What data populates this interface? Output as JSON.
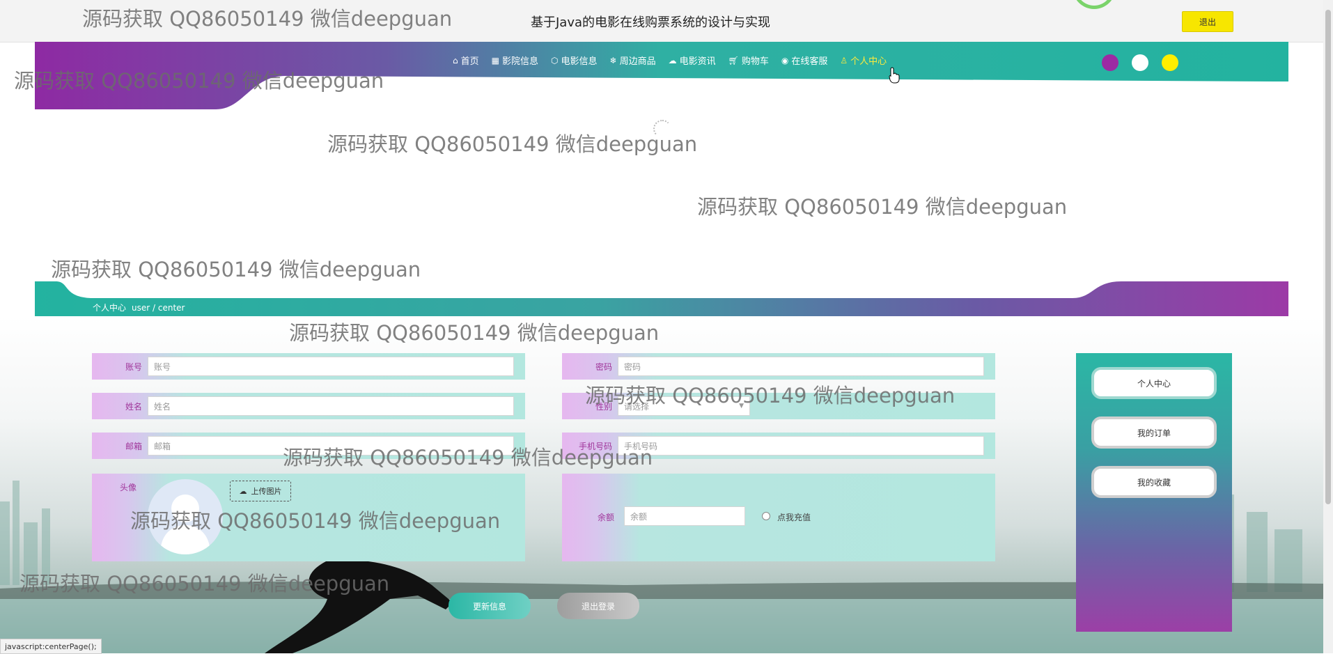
{
  "header": {
    "title": "基于Java的电影在线购票系统的设计与实现",
    "logout_label": "退出"
  },
  "nav": {
    "items": [
      {
        "label": "首页",
        "icon": "home-icon"
      },
      {
        "label": "影院信息",
        "icon": "grid-icon"
      },
      {
        "label": "电影信息",
        "icon": "cube-icon"
      },
      {
        "label": "周边商品",
        "icon": "snowflake-icon"
      },
      {
        "label": "电影资讯",
        "icon": "news-icon"
      },
      {
        "label": "购物车",
        "icon": "cart-icon"
      },
      {
        "label": "在线客服",
        "icon": "chat-icon"
      },
      {
        "label": "个人中心",
        "icon": "user-icon",
        "active": true
      }
    ],
    "theme_colors": [
      "#9c2aa3",
      "#ffffff",
      "#ffee00"
    ]
  },
  "breadcrumb": {
    "current": "个人中心",
    "path": "user / center"
  },
  "form": {
    "account": {
      "label": "账号",
      "placeholder": "账号"
    },
    "password": {
      "label": "密码",
      "placeholder": "密码"
    },
    "name": {
      "label": "姓名",
      "placeholder": "姓名"
    },
    "gender": {
      "label": "性别",
      "placeholder": "请选择"
    },
    "email": {
      "label": "邮箱",
      "placeholder": "邮箱"
    },
    "phone": {
      "label": "手机号码",
      "placeholder": "手机号码"
    },
    "avatar": {
      "label": "头像",
      "upload_label": "上传图片"
    },
    "balance": {
      "label": "余额",
      "placeholder": "余额",
      "recharge_label": "点我充值"
    }
  },
  "actions": {
    "update_label": "更新信息",
    "logout_label": "退出登录"
  },
  "sidebar": {
    "items": [
      "个人中心",
      "我的订单",
      "我的收藏"
    ]
  },
  "watermark": "源码获取 QQ86050149 微信deepguan",
  "status_bar": "javascript:centerPage();"
}
